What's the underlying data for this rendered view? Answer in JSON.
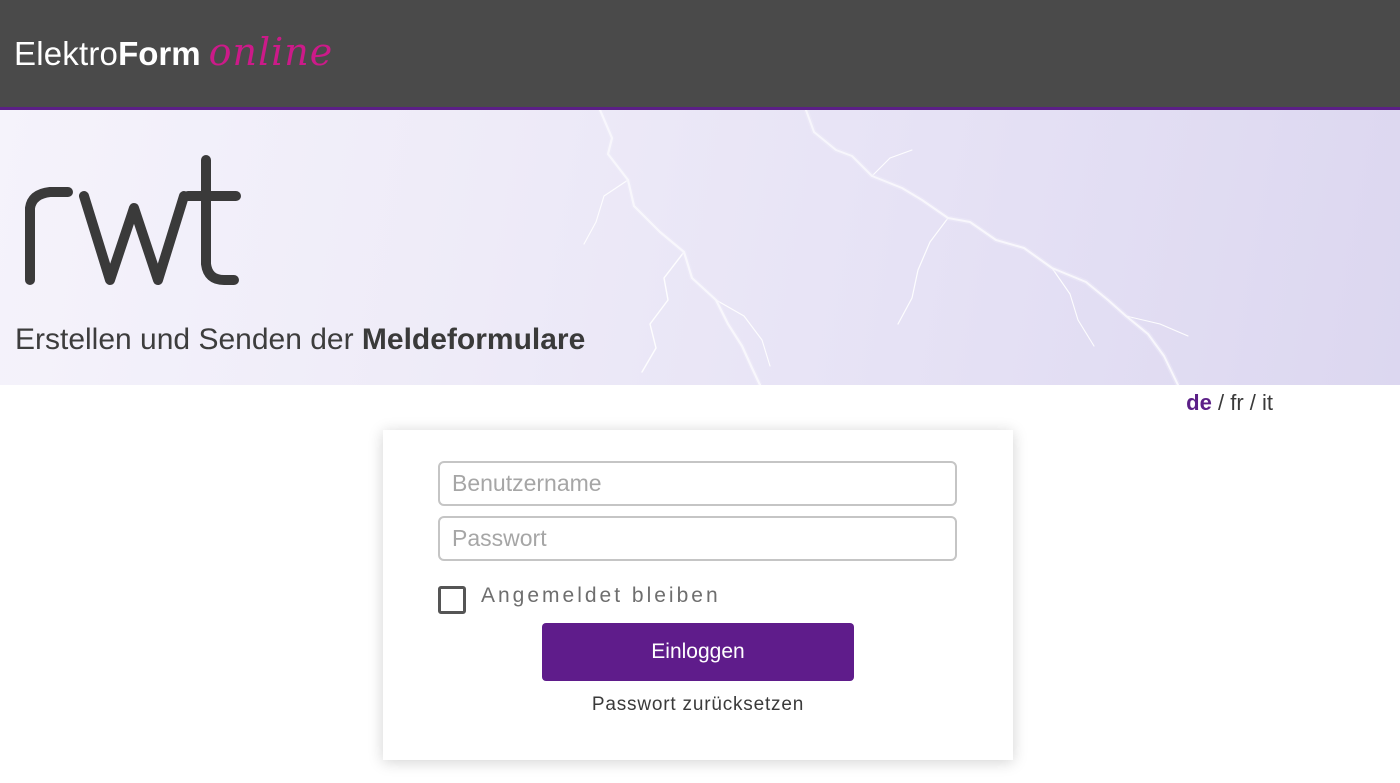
{
  "header": {
    "logo_part1": "Elektro",
    "logo_part2": "Form",
    "logo_script": "online",
    "accent_color": "#cc1a89",
    "bar_color": "#4a4a4a",
    "border_color": "#5b1f87"
  },
  "banner": {
    "brand": "rwt",
    "tagline_light": "Erstellen und Senden der ",
    "tagline_bold": "Meldeformulare"
  },
  "language": {
    "options": [
      "de",
      "fr",
      "it"
    ],
    "active": "de",
    "separator": " / "
  },
  "login": {
    "username_placeholder": "Benutzername",
    "username_value": "",
    "password_placeholder": "Passwort",
    "password_value": "",
    "remember_label": "Angemeldet bleiben",
    "remember_checked": false,
    "submit_label": "Einloggen",
    "submit_color": "#5f1c8b",
    "reset_label": "Passwort zurücksetzen"
  }
}
